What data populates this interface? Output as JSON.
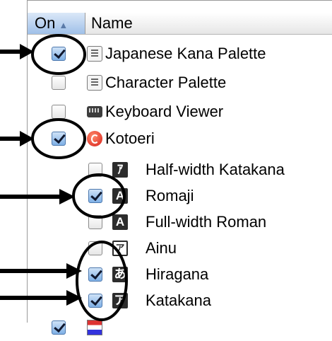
{
  "table": {
    "columns": {
      "on": "On",
      "name": "Name"
    },
    "rows": [
      {
        "label": "Japanese Kana Palette",
        "checked": true,
        "icon": "palette-icon"
      },
      {
        "label": "Character Palette",
        "checked": false,
        "icon": "palette-icon"
      },
      {
        "label": "Keyboard Viewer",
        "checked": false,
        "icon": "keyboard-icon"
      },
      {
        "label": "Kotoeri",
        "checked": true,
        "icon": "kotoeri-icon"
      },
      {
        "label": "Half-width Katakana",
        "checked": false,
        "icon": "half-width-katakana-icon",
        "glyph": "ｱ"
      },
      {
        "label": "Romaji",
        "checked": true,
        "icon": "romaji-icon",
        "glyph": "A"
      },
      {
        "label": "Full-width Roman",
        "checked": false,
        "icon": "full-width-roman-icon",
        "glyph": "A"
      },
      {
        "label": "Ainu",
        "checked": false,
        "icon": "ainu-icon",
        "glyph": "ア"
      },
      {
        "label": "Hiragana",
        "checked": true,
        "icon": "hiragana-icon",
        "glyph": "あ"
      },
      {
        "label": "Katakana",
        "checked": true,
        "icon": "katakana-icon",
        "glyph": "ア"
      }
    ]
  },
  "colors": {
    "header_selected": "#9fc0e8",
    "checkbox_checked": "#7fb0e6",
    "annotation": "#000000"
  }
}
